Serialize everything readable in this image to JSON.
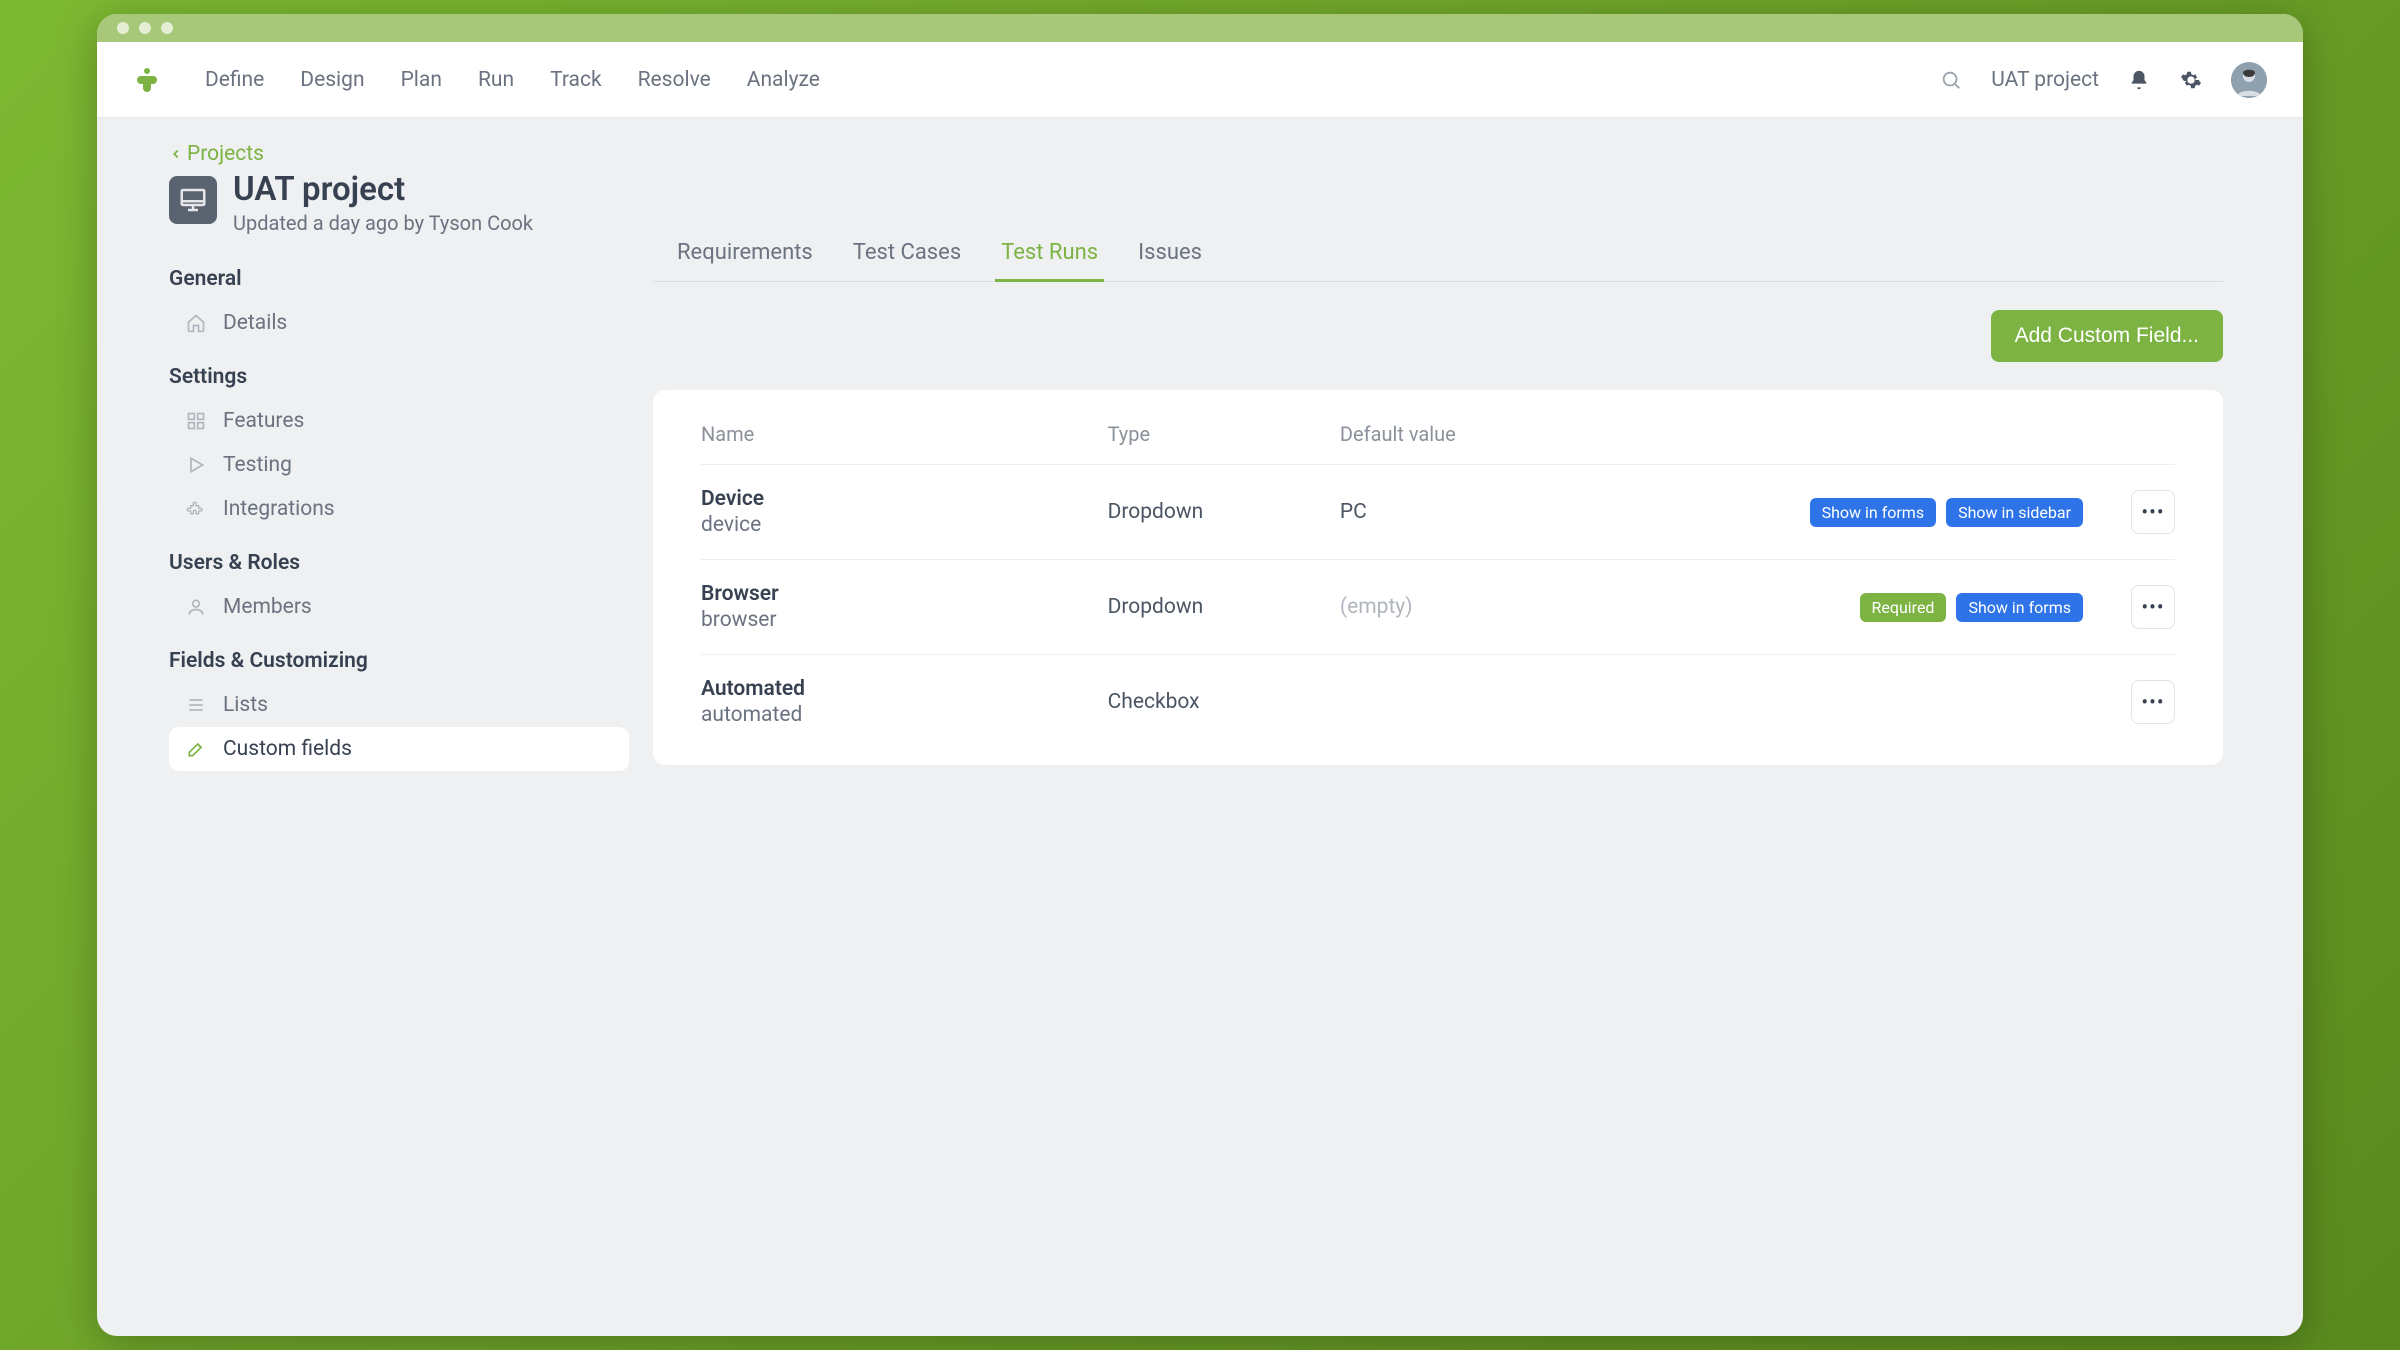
{
  "nav": {
    "items": [
      "Define",
      "Design",
      "Plan",
      "Run",
      "Track",
      "Resolve",
      "Analyze"
    ],
    "project_label": "UAT project"
  },
  "breadcrumb": {
    "label": "Projects"
  },
  "project": {
    "title": "UAT project",
    "subtitle": "Updated a day ago by Tyson Cook"
  },
  "sidebar": {
    "sections": [
      {
        "title": "General",
        "items": [
          {
            "label": "Details",
            "icon": "home"
          }
        ]
      },
      {
        "title": "Settings",
        "items": [
          {
            "label": "Features",
            "icon": "grid"
          },
          {
            "label": "Testing",
            "icon": "play"
          },
          {
            "label": "Integrations",
            "icon": "puzzle"
          }
        ]
      },
      {
        "title": "Users & Roles",
        "items": [
          {
            "label": "Members",
            "icon": "user"
          }
        ]
      },
      {
        "title": "Fields & Customizing",
        "items": [
          {
            "label": "Lists",
            "icon": "list"
          },
          {
            "label": "Custom fields",
            "icon": "edit",
            "active": true
          }
        ]
      }
    ]
  },
  "tabs": {
    "items": [
      "Requirements",
      "Test Cases",
      "Test Runs",
      "Issues"
    ],
    "active_index": 2
  },
  "actions": {
    "add_field": "Add Custom Field..."
  },
  "table": {
    "columns": [
      "Name",
      "Type",
      "Default value"
    ],
    "rows": [
      {
        "name": "Device",
        "slug": "device",
        "type": "Dropdown",
        "default": "PC",
        "badges": [
          {
            "text": "Show in forms",
            "color": "blue"
          },
          {
            "text": "Show in sidebar",
            "color": "blue"
          }
        ]
      },
      {
        "name": "Browser",
        "slug": "browser",
        "type": "Dropdown",
        "default": "(empty)",
        "default_is_empty": true,
        "badges": [
          {
            "text": "Required",
            "color": "green"
          },
          {
            "text": "Show in forms",
            "color": "blue"
          }
        ]
      },
      {
        "name": "Automated",
        "slug": "automated",
        "type": "Checkbox",
        "default": "",
        "badges": []
      }
    ]
  }
}
